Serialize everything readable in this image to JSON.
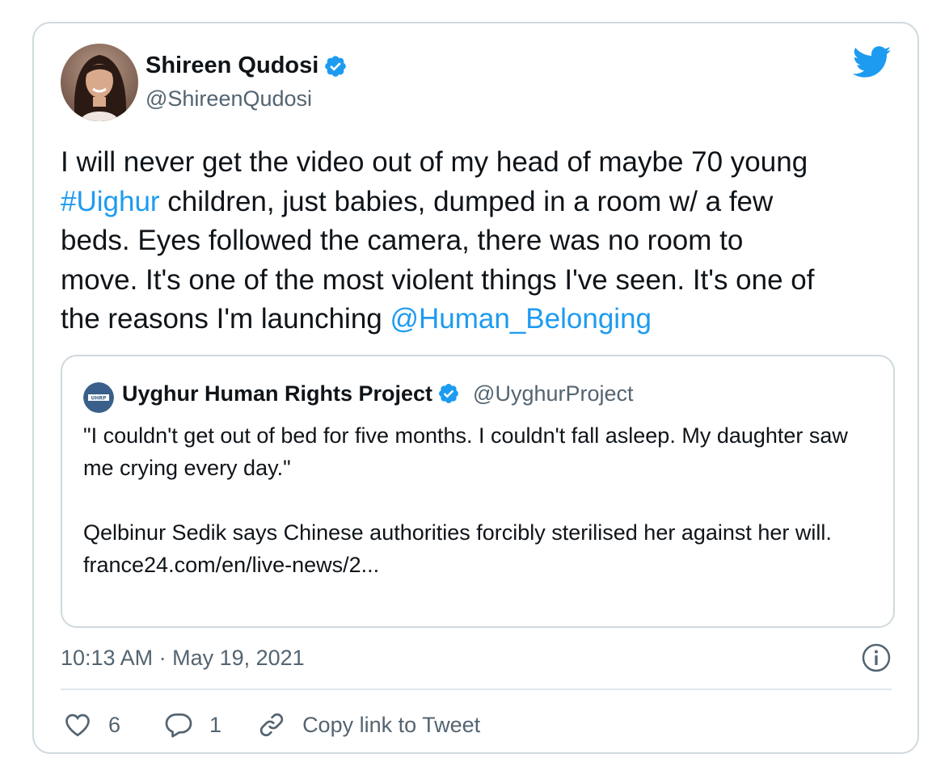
{
  "colors": {
    "accent": "#1d9bf0",
    "text": "#0f1419",
    "muted": "#536471",
    "border": "#cfd9de"
  },
  "author": {
    "name": "Shireen Qudosi",
    "handle": "@ShireenQudosi",
    "verified_icon": "verified-badge-icon",
    "avatar_icon": "avatar-photo"
  },
  "brand_icon": "twitter-bird-icon",
  "tweet": {
    "segments": [
      {
        "text": "I will never get the video out of my head of maybe 70 young\n",
        "link": false
      },
      {
        "text": "#Uighur",
        "link": true
      },
      {
        "text": " children, just babies, dumped in a room w/ a few\nbeds. Eyes followed the camera, there was no room to\nmove. It's one of the most violent things I've seen. It's one of\nthe reasons I'm launching ",
        "link": false
      },
      {
        "text": "@Human_Belonging",
        "link": true
      }
    ]
  },
  "quote": {
    "name": "Uyghur Human Rights Project",
    "handle": "@UyghurProject",
    "avatar_icon": "uhrp-logo",
    "avatar_text": "UHRP",
    "paragraph1": "\"I couldn't get out of bed for five months. I couldn't fall asleep. My daughter saw me crying every day.\"",
    "paragraph2": "Qelbinur Sedik says Chinese authorities forcibly sterilised her against her will.",
    "link": "france24.com/en/live-news/2..."
  },
  "meta": {
    "timestamp": "10:13 AM · May 19, 2021",
    "info_icon": "info-icon"
  },
  "actions": {
    "likes": "6",
    "replies": "1",
    "copy_link": "Copy link to Tweet",
    "like_icon": "heart-icon",
    "reply_icon": "reply-bubble-icon",
    "link_icon": "link-icon"
  }
}
